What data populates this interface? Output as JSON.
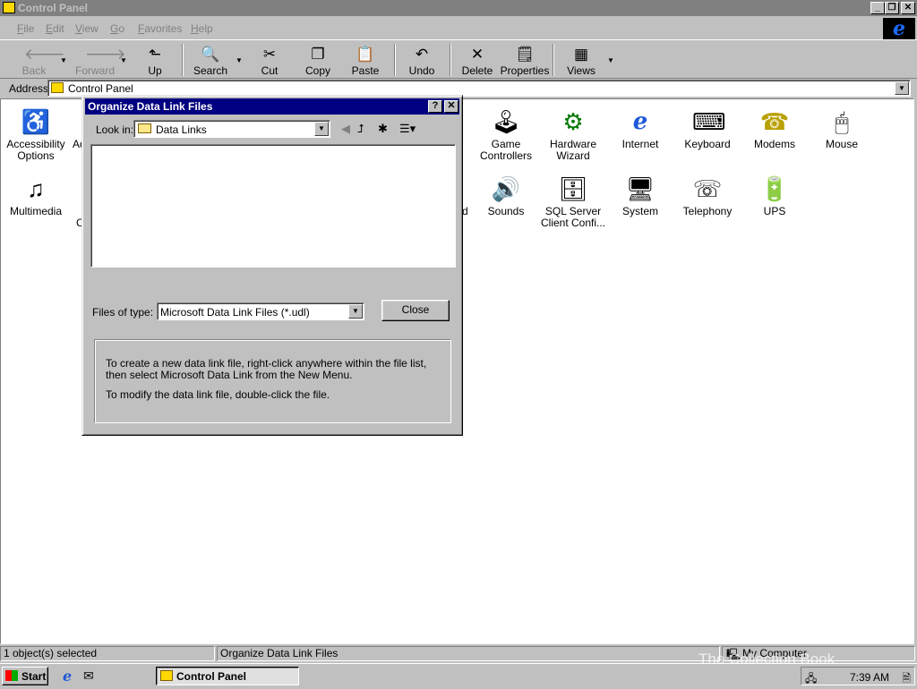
{
  "window": {
    "title": "Control Panel",
    "buttons": {
      "minimize": "_",
      "restore": "❐",
      "close": "✕"
    }
  },
  "menu": [
    {
      "label": "File",
      "accel": "F",
      "rest": "ile"
    },
    {
      "label": "Edit",
      "accel": "E",
      "rest": "dit"
    },
    {
      "label": "View",
      "accel": "V",
      "rest": "iew"
    },
    {
      "label": "Go",
      "accel": "G",
      "rest": "o"
    },
    {
      "label": "Favorites",
      "accel": "F",
      "rest": "avorites"
    },
    {
      "label": "Help",
      "accel": "H",
      "rest": "elp"
    }
  ],
  "toolbar": {
    "back": "Back",
    "forward": "Forward",
    "up": "Up",
    "search": "Search",
    "cut": "Cut",
    "copy": "Copy",
    "paste": "Paste",
    "undo": "Undo",
    "delete": "Delete",
    "properties": "Properties",
    "views": "Views"
  },
  "address": {
    "label": "Address",
    "value": "Control Panel"
  },
  "items": [
    {
      "label1": "Accessibility",
      "label2": "Options",
      "icon": "accessibility-icon",
      "glyph": "♿"
    },
    {
      "label1": "Ad",
      "label2": "",
      "icon": "partial-icon",
      "glyph": ""
    },
    {
      "label1": "Game",
      "label2": "Controllers",
      "icon": "joystick-icon",
      "glyph": "🕹"
    },
    {
      "label1": "Hardware",
      "label2": "Wizard",
      "icon": "hardware-icon",
      "glyph": "⚙"
    },
    {
      "label1": "Internet",
      "label2": "",
      "icon": "internet-icon",
      "glyph": "e"
    },
    {
      "label1": "Keyboard",
      "label2": "",
      "icon": "keyboard-icon",
      "glyph": "⌨"
    },
    {
      "label1": "Modems",
      "label2": "",
      "icon": "modem-icon",
      "glyph": "☎"
    },
    {
      "label1": "Mouse",
      "label2": "",
      "icon": "mouse-icon",
      "glyph": "🖱"
    },
    {
      "label1": "Multimedia",
      "label2": "",
      "icon": "multimedia-icon",
      "glyph": "♫"
    },
    {
      "label1": "C",
      "label2": "",
      "icon": "partial-icon",
      "glyph": ""
    },
    {
      "label1": "d",
      "label2": "",
      "icon": "partial-icon",
      "glyph": ""
    },
    {
      "label1": "Sounds",
      "label2": "",
      "icon": "sounds-icon",
      "glyph": "🔊"
    },
    {
      "label1": "SQL Server",
      "label2": "Client Confi...",
      "icon": "sql-server-icon",
      "glyph": "🗄"
    },
    {
      "label1": "System",
      "label2": "",
      "icon": "system-icon",
      "glyph": "🖥"
    },
    {
      "label1": "Telephony",
      "label2": "",
      "icon": "telephony-icon",
      "glyph": "☏"
    },
    {
      "label1": "UPS",
      "label2": "",
      "icon": "ups-icon",
      "glyph": "🔋"
    }
  ],
  "dialog": {
    "title": "Organize Data Link Files",
    "help_button": "?",
    "close_x": "✕",
    "lookin_label": "Look in:",
    "lookin_value": "Data Links",
    "filetype_label": "Files of type:",
    "filetype_value": "Microsoft Data Link Files (*.udl)",
    "close_button": "Close",
    "info_line1": "To create a new data link file, right-click anywhere within the file list, then select Microsoft Data Link from the New Menu.",
    "info_line2": "To modify the data link file, double-click the file."
  },
  "status": {
    "left": "1 object(s) selected",
    "middle": "Organize Data Link Files",
    "right": "My Computer"
  },
  "taskbar": {
    "start": "Start",
    "task": "Control Panel",
    "clock": "7:39 AM"
  },
  "watermark": "The Collection Book"
}
